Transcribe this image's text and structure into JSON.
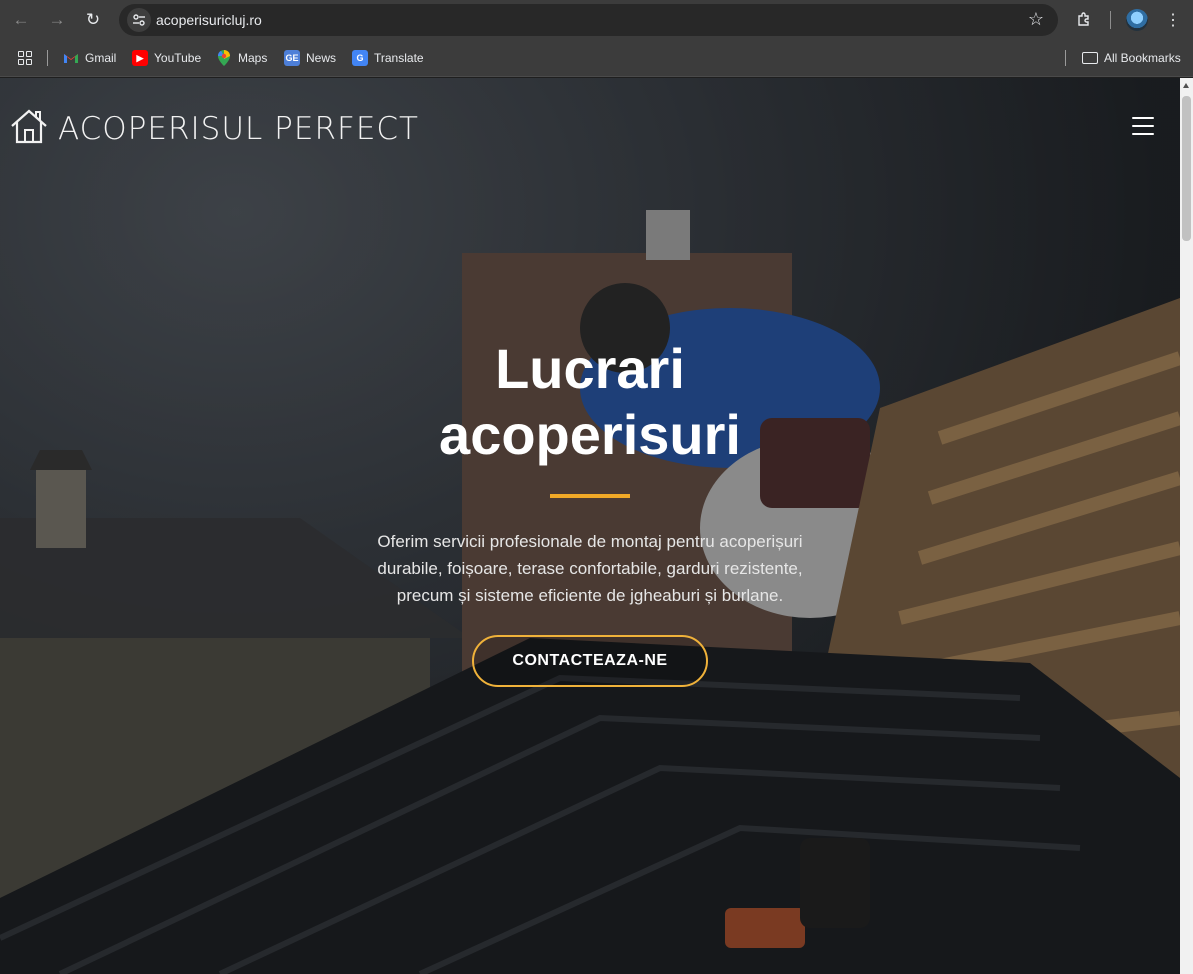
{
  "browser": {
    "url": "acoperisuricluj.ro",
    "bookmarks": [
      {
        "label": "Gmail",
        "icon": "gmail-icon"
      },
      {
        "label": "YouTube",
        "icon": "youtube-icon"
      },
      {
        "label": "Maps",
        "icon": "maps-icon"
      },
      {
        "label": "News",
        "icon": "news-icon"
      },
      {
        "label": "Translate",
        "icon": "translate-icon"
      }
    ],
    "all_bookmarks_label": "All Bookmarks"
  },
  "site": {
    "logo_text": "ACOPERISUL PERFECT",
    "logo_icon": "house-icon",
    "menu_icon": "hamburger-icon"
  },
  "hero": {
    "title_line1": "Lucrari",
    "title_line2": "acoperisuri",
    "description": "Oferim servicii profesionale de montaj pentru acoperișuri durabile, foișoare, terase confortabile, garduri rezistente, precum și sisteme eficiente de jgheaburi și burlane.",
    "cta_label": "CONTACTEAZA-NE"
  },
  "colors": {
    "accent": "#f0a827",
    "chrome_bg": "#3c3c3c",
    "omnibox_bg": "#282828"
  }
}
